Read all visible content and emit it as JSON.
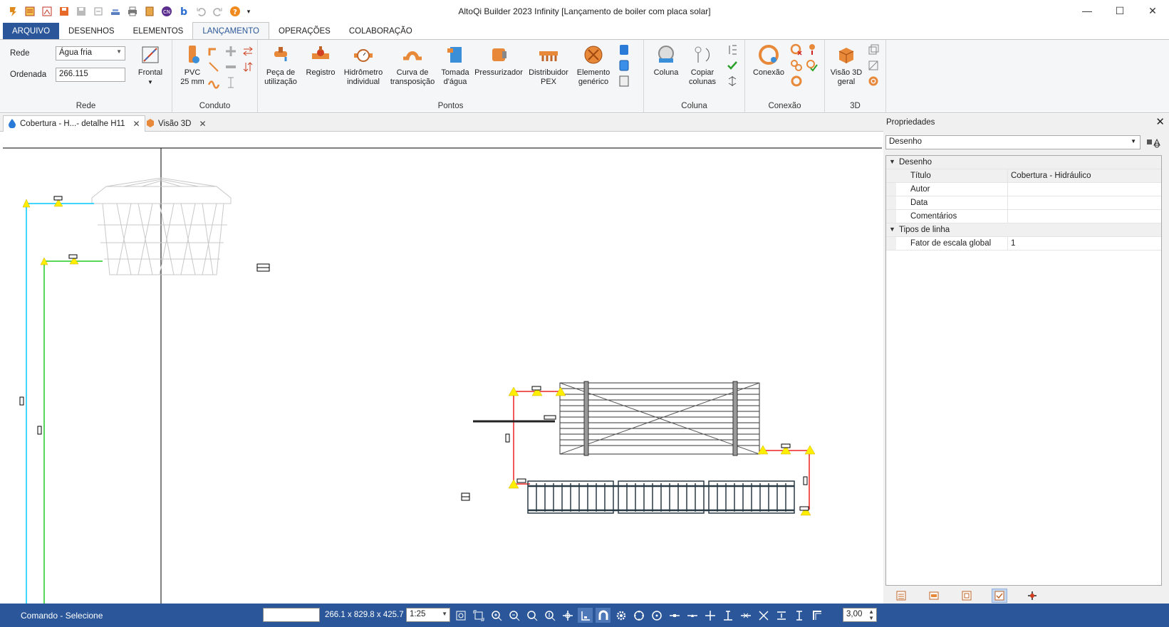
{
  "window": {
    "title": "AltoQi Builder 2023 Infinity [Lançamento de boiler com placa solar]",
    "minimize": "—",
    "maximize": "☐",
    "close": "✕"
  },
  "ribbon_tabs": [
    {
      "label": "ARQUIVO"
    },
    {
      "label": "DESENHOS"
    },
    {
      "label": "ELEMENTOS"
    },
    {
      "label": "LANÇAMENTO"
    },
    {
      "label": "OPERAÇÕES"
    },
    {
      "label": "COLABORAÇÃO"
    }
  ],
  "rede_group": {
    "label": "Rede",
    "rede_label": "Rede",
    "rede_value": "Água fria",
    "ordenada_label": "Ordenada",
    "ordenada_value": "266.115",
    "frontal_label": "Frontal"
  },
  "conduto_group": {
    "label": "Conduto",
    "pvc_line1": "PVC",
    "pvc_line2": "25 mm"
  },
  "pontos_group": {
    "label": "Pontos",
    "buttons": [
      {
        "line1": "Peça de",
        "line2": "utilização"
      },
      {
        "line1": "Registro",
        "line2": ""
      },
      {
        "line1": "Hidrômetro",
        "line2": "individual"
      },
      {
        "line1": "Curva de",
        "line2": "transposição"
      },
      {
        "line1": "Tomada",
        "line2": "d'água"
      },
      {
        "line1": "Pressurizador",
        "line2": ""
      },
      {
        "line1": "Distribuidor",
        "line2": "PEX"
      },
      {
        "line1": "Elemento",
        "line2": "genérico"
      }
    ]
  },
  "coluna_group": {
    "label": "Coluna",
    "coluna": "Coluna",
    "copiar_line1": "Copiar",
    "copiar_line2": "colunas"
  },
  "conexao_group": {
    "label": "Conexão",
    "conexao": "Conexão"
  },
  "group_3d": {
    "label": "3D",
    "visao_line1": "Visão 3D",
    "visao_line2": "geral"
  },
  "doc_tabs": [
    {
      "label": "Cobertura - H...- detalhe H11",
      "close": "✕"
    },
    {
      "label": "Visão 3D",
      "close": "✕"
    }
  ],
  "properties": {
    "header": "Propriedades",
    "close": "✕",
    "selected": "Desenho",
    "categories": [
      {
        "name": "Desenho",
        "rows": [
          {
            "name": "Título",
            "value": "Cobertura - Hidráulico"
          },
          {
            "name": "Autor",
            "value": ""
          },
          {
            "name": "Data",
            "value": ""
          },
          {
            "name": "Comentários",
            "value": ""
          }
        ]
      },
      {
        "name": "Tipos de linha",
        "rows": [
          {
            "name": "Fator de escala global",
            "value": "1"
          }
        ]
      }
    ]
  },
  "status": {
    "command": "Comando - Selecione",
    "coords": "266.1 x 829.8 x 425.7",
    "scale": "1:25",
    "spin_value": "3,00"
  },
  "colors": {
    "accent": "#2b579a",
    "pipe_cold": "#00c0ff",
    "pipe_green": "#22cc22",
    "pipe_red": "#ee2222",
    "marker_yellow": "#ffee00"
  }
}
